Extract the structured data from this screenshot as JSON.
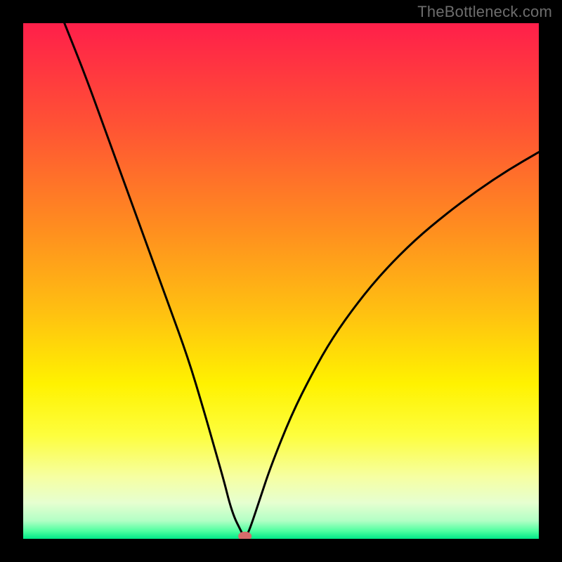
{
  "watermark": "TheBottleneck.com",
  "chart_data": {
    "type": "line",
    "title": "",
    "xlabel": "",
    "ylabel": "",
    "xlim": [
      0,
      100
    ],
    "ylim": [
      0,
      100
    ],
    "grid": false,
    "legend": false,
    "background_gradient_stops": [
      {
        "offset": 0.0,
        "color": "#ff1f4a"
      },
      {
        "offset": 0.2,
        "color": "#ff5334"
      },
      {
        "offset": 0.4,
        "color": "#ff8e1f"
      },
      {
        "offset": 0.56,
        "color": "#ffc011"
      },
      {
        "offset": 0.7,
        "color": "#fff200"
      },
      {
        "offset": 0.8,
        "color": "#fdfe3e"
      },
      {
        "offset": 0.88,
        "color": "#f6ffa2"
      },
      {
        "offset": 0.93,
        "color": "#e6ffd0"
      },
      {
        "offset": 0.965,
        "color": "#b2ffc5"
      },
      {
        "offset": 0.985,
        "color": "#4effa0"
      },
      {
        "offset": 1.0,
        "color": "#00e887"
      }
    ],
    "series": [
      {
        "name": "bottleneck-curve",
        "color": "#000000",
        "x": [
          8,
          12,
          16,
          20,
          24,
          28,
          32,
          35,
          37,
          39,
          40,
          41,
          42,
          42.7,
          43.3,
          44,
          46,
          48,
          52,
          56,
          60,
          65,
          70,
          76,
          82,
          88,
          94,
          100
        ],
        "y": [
          100,
          90,
          79,
          68,
          57,
          46,
          35,
          25,
          18,
          11,
          7,
          4,
          2,
          0.6,
          0.6,
          2,
          8,
          14,
          24,
          32,
          39,
          46,
          52,
          58,
          63,
          67.5,
          71.5,
          75
        ]
      }
    ],
    "marker": {
      "name": "optimal-point",
      "x": 43,
      "y": 0.5,
      "rx": 1.3,
      "ry": 0.9,
      "color": "#d76b6b"
    }
  }
}
